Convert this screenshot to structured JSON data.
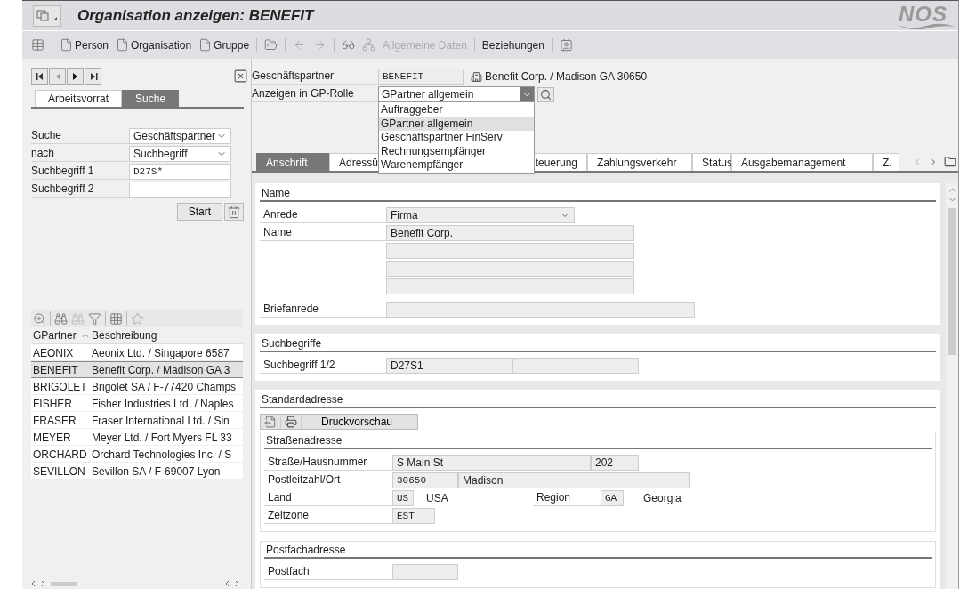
{
  "window": {
    "title": "Organisation anzeigen: BENEFIT",
    "logo": "NOS"
  },
  "toolbar": [
    {
      "label": "Person",
      "disabled": false
    },
    {
      "label": "Organisation",
      "disabled": false
    },
    {
      "label": "Gruppe",
      "disabled": false
    },
    {
      "label": "Allgemeine Daten",
      "disabled": true
    },
    {
      "label": "Beziehungen",
      "disabled": false
    }
  ],
  "left_panel": {
    "tabs": [
      {
        "label": "Arbeitsvorrat",
        "selected": false
      },
      {
        "label": "Suche",
        "selected": true
      }
    ],
    "search": [
      {
        "label": "Suche",
        "kind": "dropdown",
        "value": "Geschäftspartner"
      },
      {
        "label": "nach",
        "kind": "dropdown",
        "value": "Suchbegriff"
      },
      {
        "label": "Suchbegriff 1",
        "kind": "input",
        "value": "D27S*"
      },
      {
        "label": "Suchbegriff 2",
        "kind": "input"
      }
    ],
    "start_button": "Start",
    "table": {
      "columns": [
        "GPartner",
        "Beschreibung"
      ],
      "rows": [
        {
          "cells": [
            "AEONIX",
            "Aeonix Ltd. / Singapore 6587"
          ],
          "selected": false
        },
        {
          "cells": [
            "BENEFIT",
            "Benefit Corp. / Madison GA 3"
          ],
          "selected": true
        },
        {
          "cells": [
            "BRIGOLET",
            "Brigolet SA / F-77420 Champs"
          ],
          "selected": false
        },
        {
          "cells": [
            "FISHER",
            "Fisher Industries Ltd. / Naples"
          ],
          "selected": false
        },
        {
          "cells": [
            "FRASER",
            "Fraser International Ltd. / Sin"
          ],
          "selected": false
        },
        {
          "cells": [
            "MEYER",
            "Meyer Ltd. / Fort Myers FL 33"
          ],
          "selected": false
        },
        {
          "cells": [
            "ORCHARD",
            "Orchard Technologies Inc. / S"
          ],
          "selected": false
        },
        {
          "cells": [
            "SEVILLON",
            "Sevillon SA / F-69007 Lyon"
          ],
          "selected": false
        }
      ]
    }
  },
  "header": {
    "partner_label": "Geschäftspartner",
    "partner_value": "BENEFIT",
    "partner_description": "Benefit Corp. / Madison GA 30650",
    "role_label": "Anzeigen in GP-Rolle",
    "role_value": "GPartner allgemein",
    "role_options": [
      {
        "label": "Auftraggeber",
        "selected": false
      },
      {
        "label": "GPartner allgemein",
        "selected": true
      },
      {
        "label": "Geschäftspartner FinServ",
        "selected": false
      },
      {
        "label": "Rechnungsempfänger",
        "selected": false
      },
      {
        "label": "Warenempfänger",
        "selected": false
      }
    ]
  },
  "tabs": [
    {
      "label": "Anschrift",
      "selected": true
    },
    {
      "label": "Adressü",
      "selected": false
    },
    {
      "label": "teuerung",
      "selected": false
    },
    {
      "label": "Zahlungsverkehr",
      "selected": false
    },
    {
      "label": "Status",
      "selected": false
    },
    {
      "label": "Ausgabemanagement",
      "selected": false
    },
    {
      "label": "Z.",
      "selected": false
    }
  ],
  "name_section": {
    "title": "Name",
    "salutation_label": "Anrede",
    "salutation": "Firma",
    "name_label": "Name",
    "name_lines": [
      "Benefit Corp."
    ],
    "letter_salutation_label": "Briefanrede"
  },
  "search_terms": {
    "title": "Suchbegriffe",
    "label": "Suchbegriff 1/2",
    "values": [
      "D27S1"
    ]
  },
  "standard_address": {
    "title": "Standardadresse",
    "print_preview": "Druckvorschau",
    "street_address": {
      "title": "Straßenadresse",
      "street_label": "Straße/Hausnummer",
      "street": "S Main St",
      "house_number": "202",
      "postal_label": "Postleitzahl/Ort",
      "postal_code": "30650",
      "city": "Madison",
      "country_label": "Land",
      "country_code": "US",
      "country": "USA",
      "region_label": "Region",
      "region_code": "GA",
      "region": "Georgia",
      "timezone_label": "Zeitzone",
      "timezone": "EST"
    },
    "po_box_address": {
      "title": "Postfachadresse",
      "po_box_label": "Postfach"
    }
  }
}
